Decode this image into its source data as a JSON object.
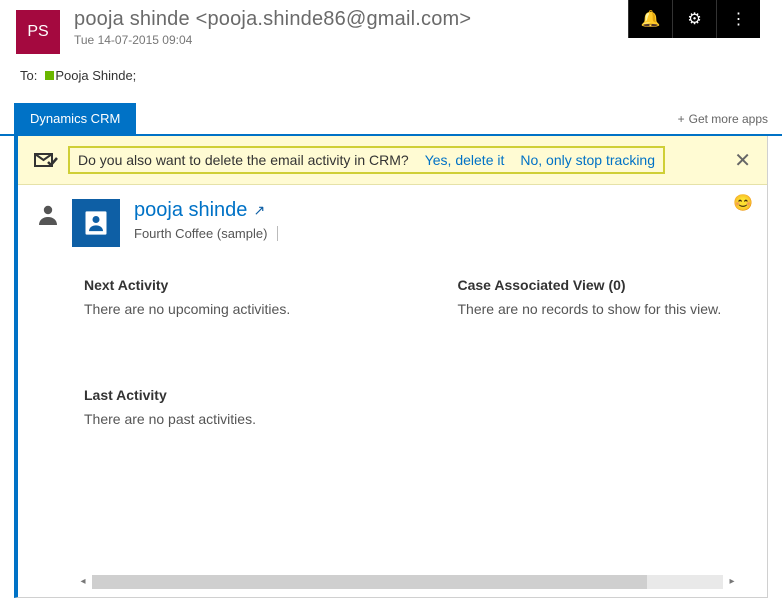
{
  "topbar": {
    "icons": {
      "bell": "🔔",
      "gear": "⚙",
      "menu": "⋮"
    }
  },
  "header": {
    "avatar_initials": "PS",
    "from_line": "pooja shinde <pooja.shinde86@gmail.com>",
    "date_line": "Tue 14-07-2015 09:04"
  },
  "to": {
    "label": "To:",
    "recipients": "Pooja Shinde;"
  },
  "tabs": {
    "crm": "Dynamics CRM",
    "get_more": "Get more apps",
    "plus": "+"
  },
  "notif": {
    "question": "Do you also want to delete the email activity in CRM?",
    "yes": "Yes, delete it",
    "no": "No, only stop tracking",
    "close": "✕"
  },
  "person": {
    "name": "pooja shinde",
    "popout": "↗",
    "company": "Fourth Coffee (sample)",
    "smiley": "😊"
  },
  "sections": {
    "next_activity_title": "Next Activity",
    "next_activity_body": "There are no upcoming activities.",
    "case_view_title": "Case Associated View (0)",
    "case_view_body": "There are no records to show for this view.",
    "last_activity_title": "Last Activity",
    "last_activity_body": "There are no past activities."
  },
  "scroll": {
    "left": "◂",
    "right": "▸"
  }
}
